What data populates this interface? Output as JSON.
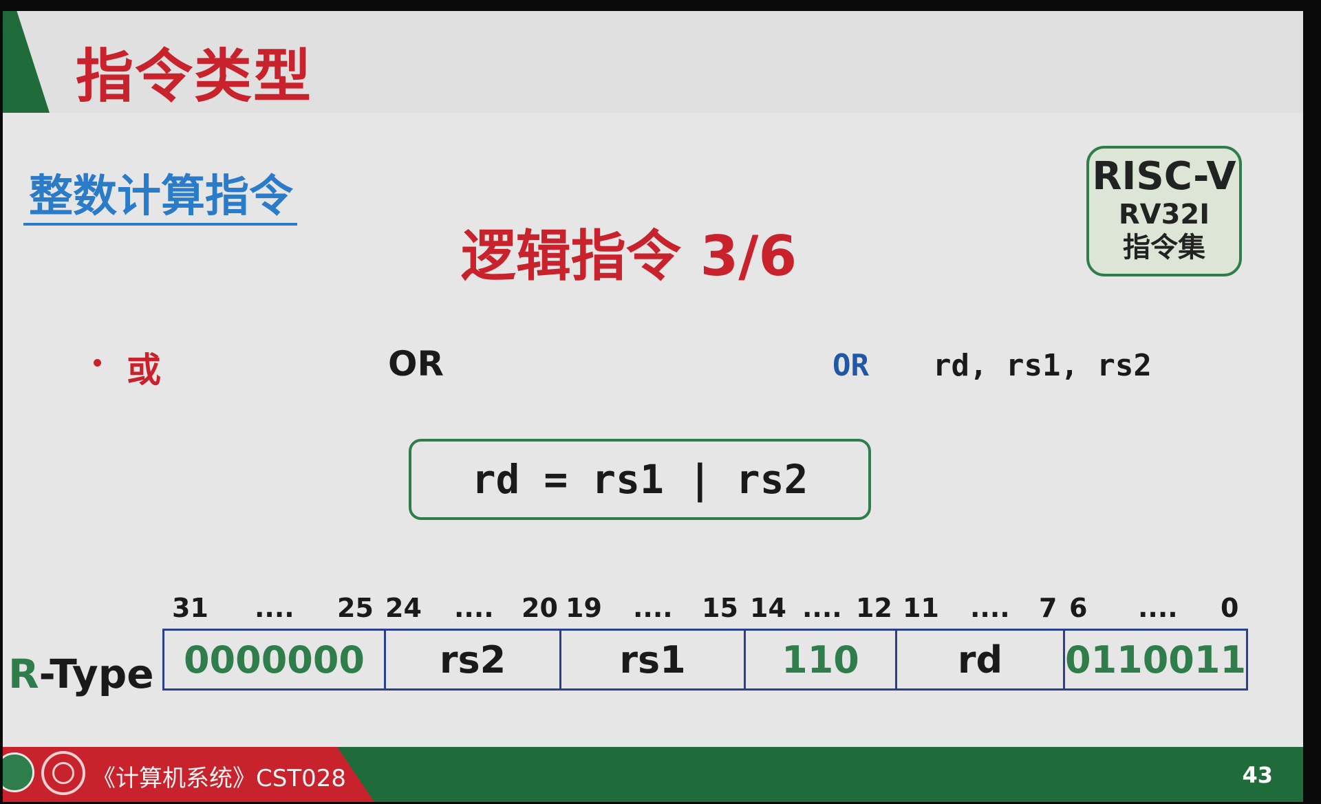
{
  "header": {
    "title": "指令类型"
  },
  "section_label": "整数计算指令",
  "subtitle": "逻辑指令 3/6",
  "badge": {
    "line1": "RISC-V",
    "line2": "RV32I",
    "line3": "指令集"
  },
  "instruction": {
    "bullet_label": "或",
    "mnemonic": "OR",
    "asm_opcode": "OR",
    "asm_operands": "rd, rs1, rs2",
    "formula": "rd = rs1 | rs2"
  },
  "encoding": {
    "type_label_prefix": "R",
    "type_label_rest": "-Type",
    "bit_labels": [
      "31",
      "....",
      "25",
      "24",
      "....",
      "20",
      "19",
      "....",
      "15",
      "14",
      "....",
      "12",
      "11",
      "....",
      "7",
      "6",
      "....",
      "0"
    ],
    "fields": [
      {
        "value": "0000000",
        "style": "green"
      },
      {
        "value": "rs2",
        "style": "dark"
      },
      {
        "value": "rs1",
        "style": "dark"
      },
      {
        "value": "110",
        "style": "green"
      },
      {
        "value": "rd",
        "style": "dark"
      },
      {
        "value": "0110011",
        "style": "green"
      }
    ]
  },
  "footer": {
    "course": "《计算机系统》CST028",
    "page": "43"
  },
  "colors": {
    "title_red": "#c8232c",
    "accent_green": "#2f7d4a",
    "section_blue": "#2a7bc8",
    "table_border": "#2a3f8f"
  }
}
